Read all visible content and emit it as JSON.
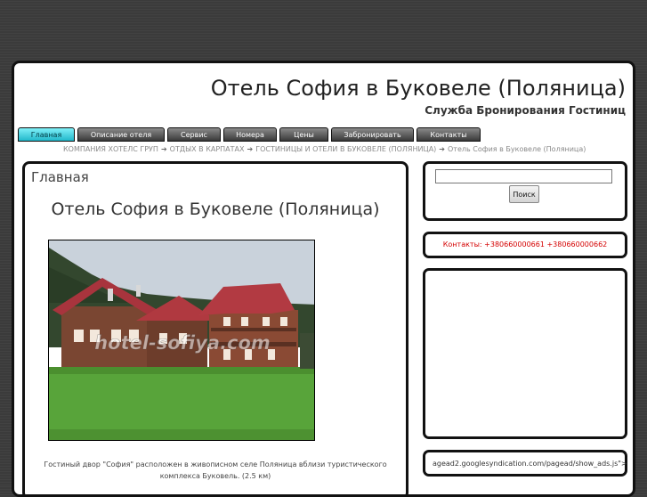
{
  "header": {
    "title": "Отель София в Буковеле (Поляница)",
    "subtitle": "Служба Бронирования Гостиниц"
  },
  "nav": [
    {
      "label": "Главная",
      "active": true
    },
    {
      "label": "Описание отеля"
    },
    {
      "label": "Сервис"
    },
    {
      "label": "Номера"
    },
    {
      "label": "Цены"
    },
    {
      "label": "Забронировать"
    },
    {
      "label": "Контакты"
    }
  ],
  "breadcrumb": {
    "items": [
      "КОМПАНИЯ ХОТЕЛС ГРУП",
      "ОТДЫХ В КАРПАТАХ",
      "ГОСТИНИЦЫ И ОТЕЛИ В БУКОВЕЛЕ (ПОЛЯНИЦА)",
      "Отель София в Буковеле (Поляница)"
    ],
    "separator": "➔"
  },
  "main": {
    "heading": "Главная",
    "title": "Отель София в Буковеле (Поляница)",
    "photo_watermark": "hotel-sofiya.com",
    "caption": "Гостиный двор \"София\" расположен в живописном селе Поляница вблизи туристического комплекса Буковель. (2.5 км)"
  },
  "sidebar": {
    "search_value": "",
    "search_button": "Поиск",
    "contacts": "Контакты: +380660000661 +380660000662",
    "ad_script": "agead2.googlesyndication.com/pagead/show_ads.js\">"
  },
  "colors": {
    "active_tab": "#21b8cb",
    "contacts_text": "#d40000",
    "frame_border": "#111111"
  }
}
